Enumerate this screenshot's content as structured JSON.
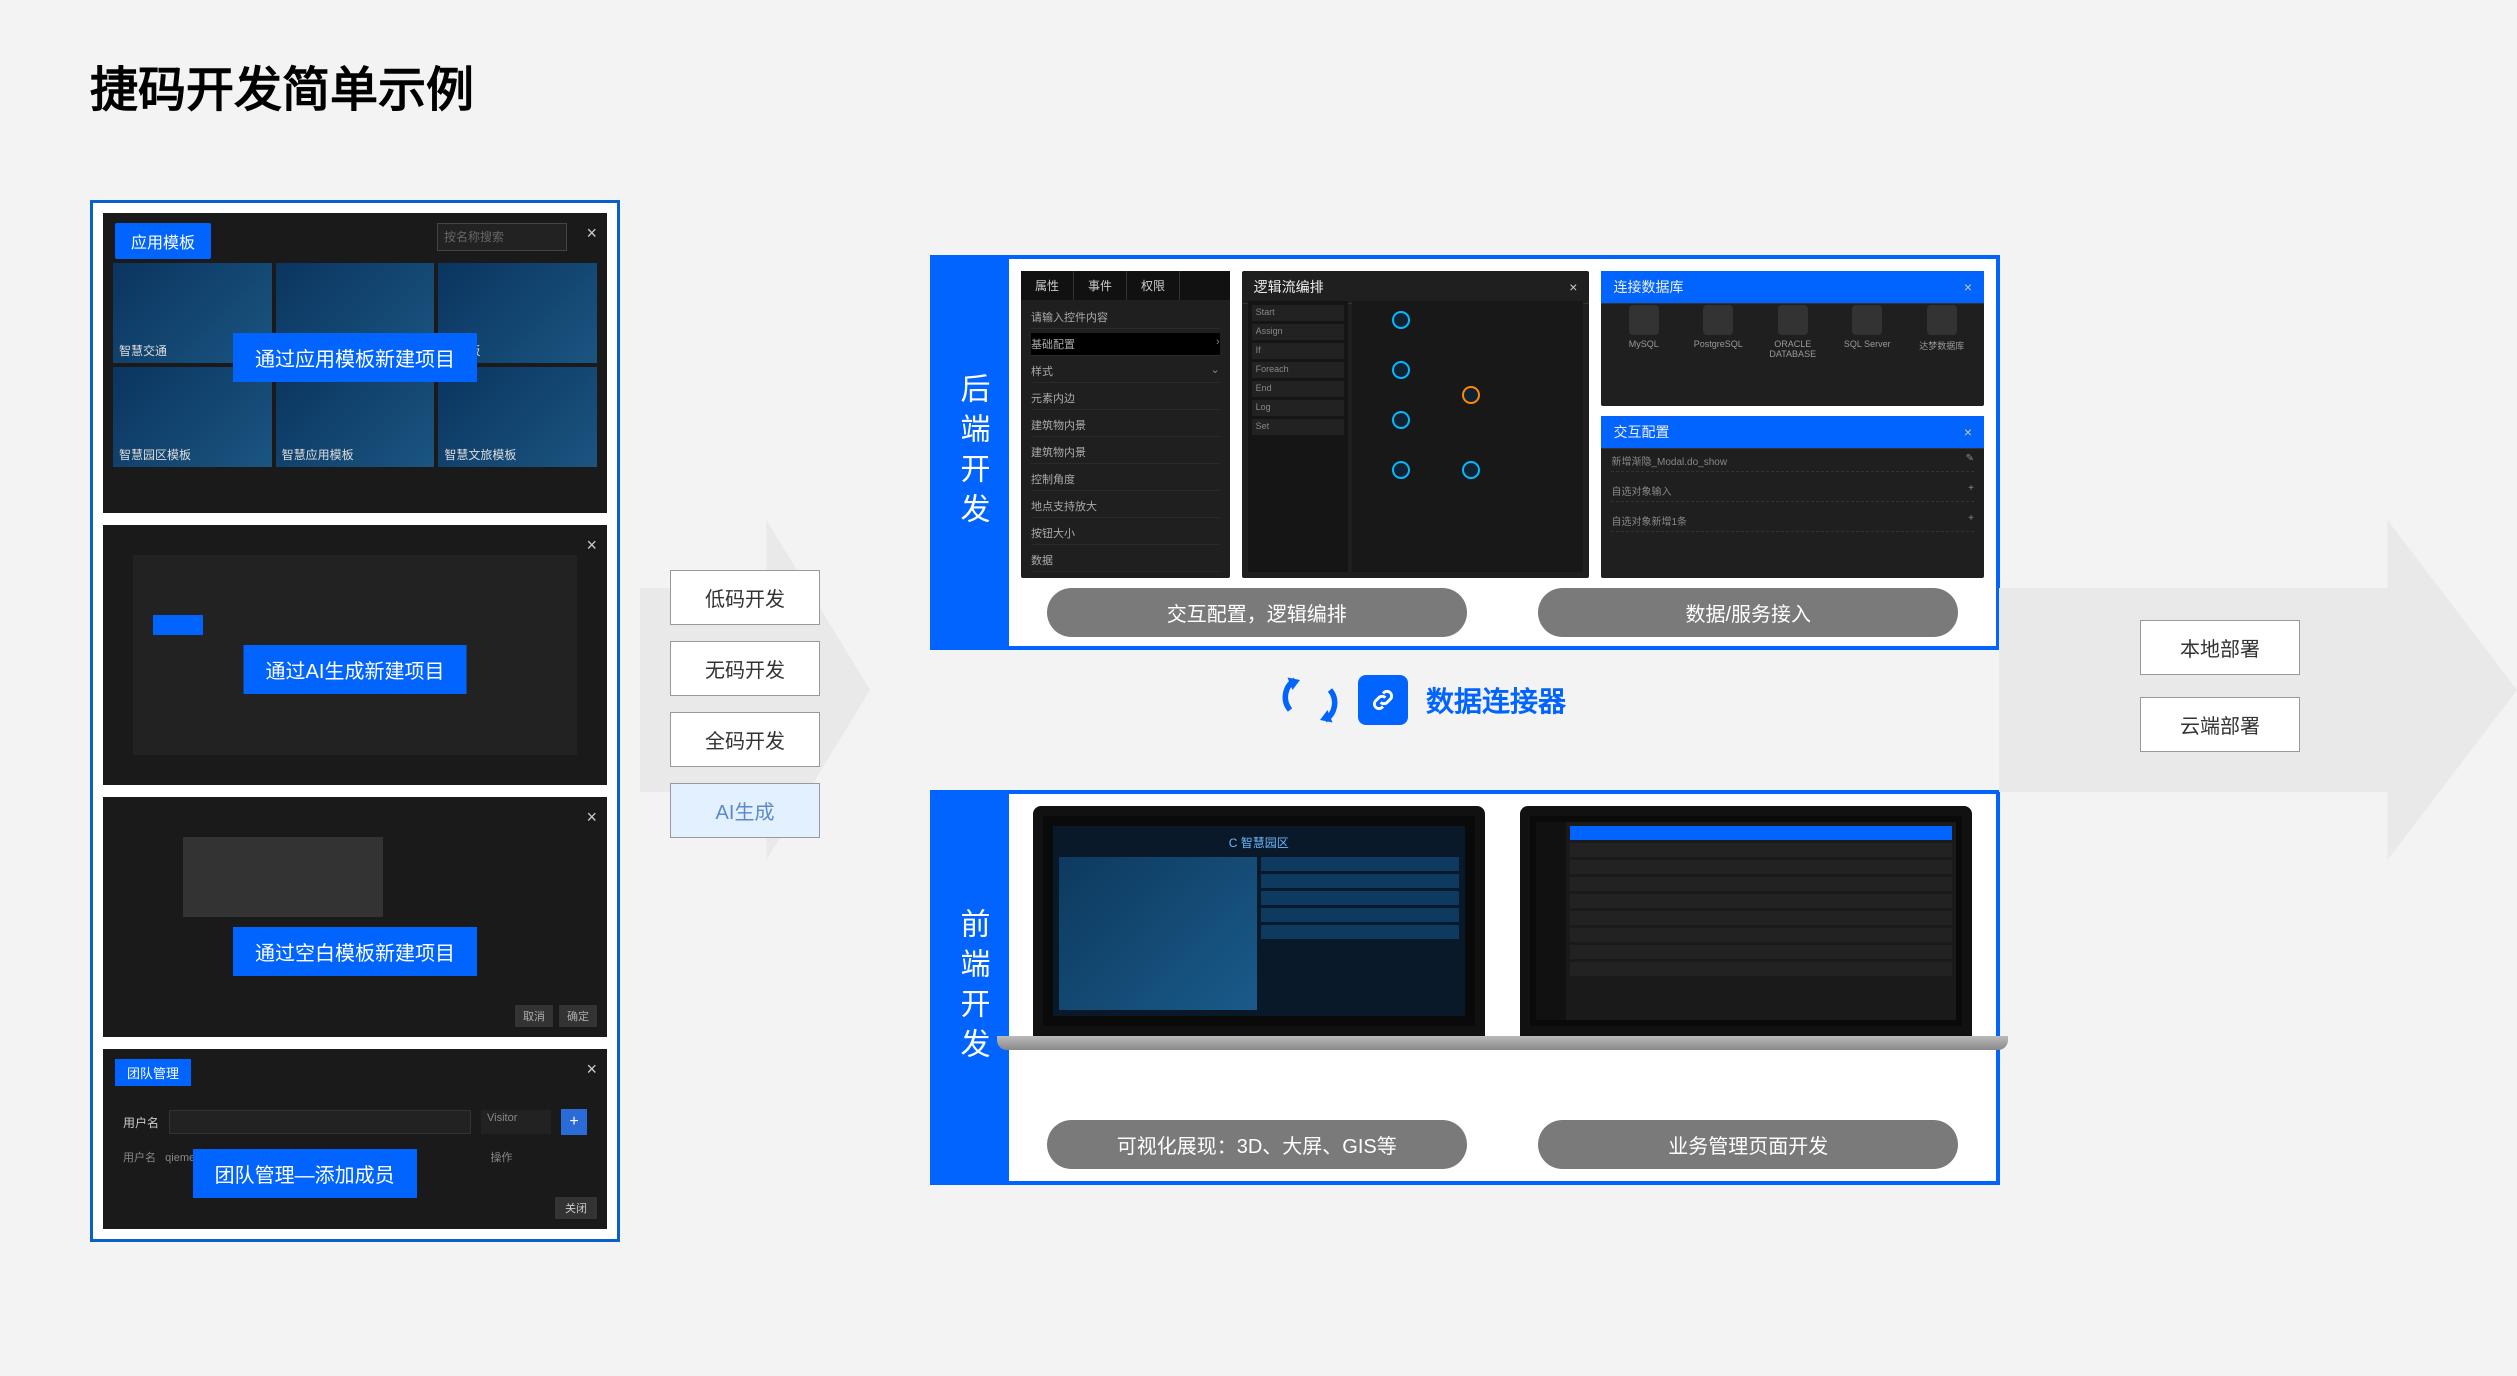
{
  "title": "捷码开发简单示例",
  "col1": {
    "panel1": {
      "tab": "应用模板",
      "search_placeholder": "按名称搜索",
      "overlay": "通过应用模板新建项目",
      "templates": [
        "智慧交通",
        "",
        "厂模板",
        "智慧园区模板",
        "智慧应用模板",
        "智慧文旅模板"
      ]
    },
    "panel2": {
      "overlay": "通过AI生成新建项目"
    },
    "panel3": {
      "overlay": "通过空白模板新建项目",
      "btn1": "取消",
      "btn2": "确定"
    },
    "panel4": {
      "title": "团队管理",
      "label_user": "用户名",
      "select": "Visitor",
      "overlay": "团队管理—添加成员",
      "row2_user": "用户名",
      "row2_name": "qiemeng",
      "row2_op": "操作",
      "close_btn": "关闭"
    }
  },
  "options": [
    "低码开发",
    "无码开发",
    "全码开发",
    "AI生成"
  ],
  "backend": {
    "vlabel": "后端开发",
    "props": {
      "tabs": [
        "属性",
        "事件",
        "权限"
      ],
      "hint": "请输入控件内容",
      "section1": "基础配置",
      "section2": "样式",
      "lines": [
        "元素内边",
        "建筑物内景",
        "建筑物内景",
        "控制角度",
        "地点支持放大",
        "按钮大小",
        "数据"
      ]
    },
    "flow": {
      "title": "逻辑流编排",
      "items": [
        "Start",
        "Assign",
        "If",
        "Foreach",
        "End",
        "Log",
        "Set"
      ]
    },
    "db": {
      "title": "连接数据库",
      "items": [
        "MySQL",
        "PostgreSQL",
        "ORACLE DATABASE",
        "SQL Server",
        "达梦数据库"
      ]
    },
    "inter": {
      "title": "交互配置",
      "rows": [
        "新增渐隐_Modal.do_show",
        "自选对象输入",
        "自选对象新增1条"
      ]
    },
    "pill1": "交互配置，逻辑编排",
    "pill2": "数据/服务接入"
  },
  "connector": {
    "text": "数据连接器"
  },
  "frontend": {
    "vlabel": "前端开发",
    "dash_title": "C 智慧园区",
    "pill1": "可视化展现：3D、大屏、GIS等",
    "pill2": "业务管理页面开发"
  },
  "deploy": [
    "本地部署",
    "云端部署"
  ]
}
